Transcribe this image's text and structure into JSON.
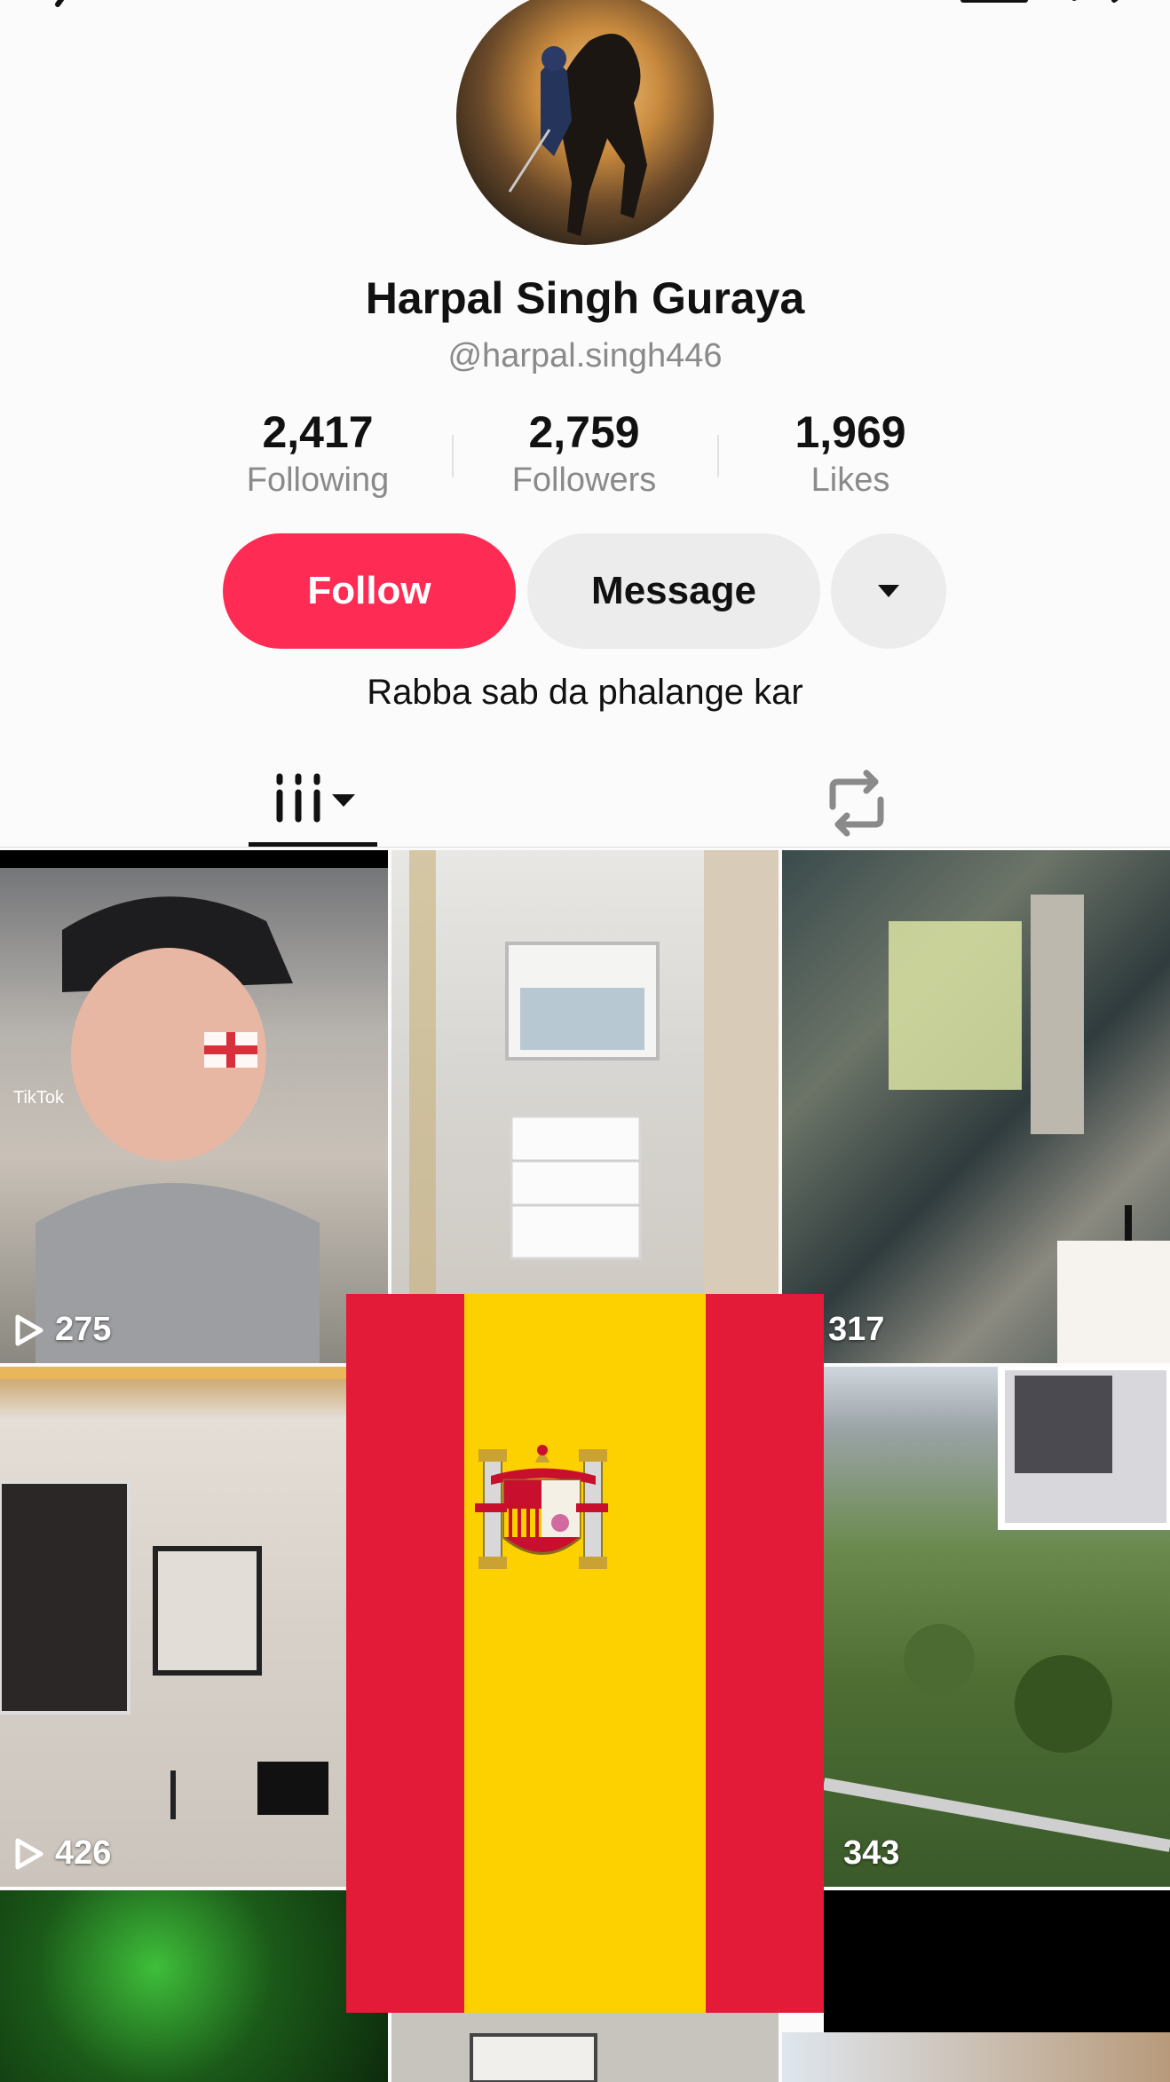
{
  "profile": {
    "name": "Harpal Singh Guraya",
    "handle": "@harpal.singh446",
    "bio": "Rabba sab da phalange kar"
  },
  "stats": {
    "following": {
      "value": "2,417",
      "label": "Following"
    },
    "followers": {
      "value": "2,759",
      "label": "Followers"
    },
    "likes": {
      "value": "1,969",
      "label": "Likes"
    }
  },
  "actions": {
    "follow_label": "Follow",
    "message_label": "Message"
  },
  "tabs": [
    {
      "name": "videos",
      "icon": "grid-icon",
      "selected": true
    },
    {
      "name": "reposts",
      "icon": "repost-icon",
      "selected": false
    }
  ],
  "videos": [
    {
      "views": "275"
    },
    {
      "views": "317"
    },
    {
      "views": "426"
    },
    {
      "views": "343"
    }
  ],
  "colors": {
    "accent": "#fe2c55",
    "flag_red": "#e31b38",
    "flag_yellow": "#fdd000"
  }
}
